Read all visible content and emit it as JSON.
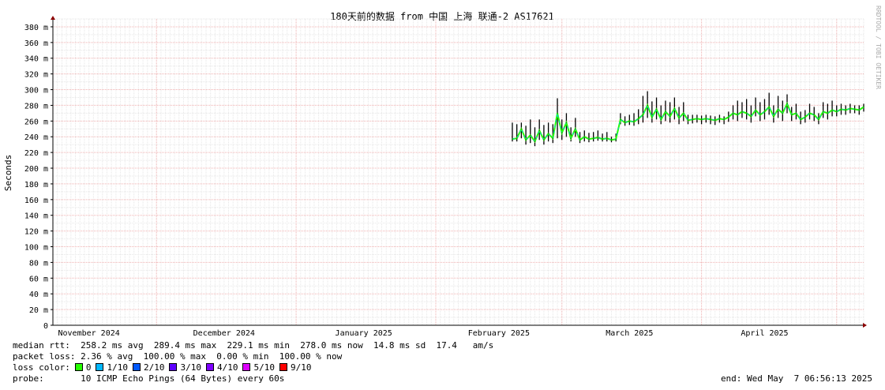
{
  "chart_data": {
    "type": "line",
    "title": "180天前的数据 from 中国 上海 联通-2 AS17621",
    "ylabel": "Seconds",
    "watermark": "RRDTOOL / TOBI OETIKER",
    "ylim": [
      0,
      390
    ],
    "yticks": [
      0,
      20,
      40,
      60,
      80,
      100,
      120,
      140,
      160,
      180,
      200,
      220,
      240,
      260,
      280,
      300,
      320,
      340,
      360,
      380
    ],
    "ytick_labels": [
      "0",
      "20 m",
      "40 m",
      "60 m",
      "80 m",
      "100 m",
      "120 m",
      "140 m",
      "160 m",
      "180 m",
      "200 m",
      "220 m",
      "240 m",
      "260 m",
      "280 m",
      "300 m",
      "320 m",
      "340 m",
      "360 m",
      "380 m"
    ],
    "xlim": [
      "2024-11-08",
      "2025-05-07"
    ],
    "xticks": [
      {
        "label": "November 2024",
        "date": "2024-11-16"
      },
      {
        "label": "December 2024",
        "date": "2024-12-16"
      },
      {
        "label": "January 2025",
        "date": "2025-01-16"
      },
      {
        "label": "February 2025",
        "date": "2025-02-15"
      },
      {
        "label": "March 2025",
        "date": "2025-03-16"
      },
      {
        "label": "April 2025",
        "date": "2025-04-15"
      }
    ],
    "grid": true,
    "series": [
      {
        "name": "median rtt",
        "x": [
          "2025-02-18",
          "2025-02-19",
          "2025-02-20",
          "2025-02-21",
          "2025-02-22",
          "2025-02-23",
          "2025-02-24",
          "2025-02-25",
          "2025-02-26",
          "2025-02-27",
          "2025-02-28",
          "2025-03-01",
          "2025-03-02",
          "2025-03-03",
          "2025-03-04",
          "2025-03-05",
          "2025-03-06",
          "2025-03-07",
          "2025-03-08",
          "2025-03-09",
          "2025-03-10",
          "2025-03-11",
          "2025-03-12",
          "2025-03-13",
          "2025-03-14",
          "2025-03-15",
          "2025-03-16",
          "2025-03-17",
          "2025-03-18",
          "2025-03-19",
          "2025-03-20",
          "2025-03-21",
          "2025-03-22",
          "2025-03-23",
          "2025-03-24",
          "2025-03-25",
          "2025-03-26",
          "2025-03-27",
          "2025-03-28",
          "2025-03-29",
          "2025-03-30",
          "2025-03-31",
          "2025-04-01",
          "2025-04-02",
          "2025-04-03",
          "2025-04-04",
          "2025-04-05",
          "2025-04-06",
          "2025-04-07",
          "2025-04-08",
          "2025-04-09",
          "2025-04-10",
          "2025-04-11",
          "2025-04-12",
          "2025-04-13",
          "2025-04-14",
          "2025-04-15",
          "2025-04-16",
          "2025-04-17",
          "2025-04-18",
          "2025-04-19",
          "2025-04-20",
          "2025-04-21",
          "2025-04-22",
          "2025-04-23",
          "2025-04-24",
          "2025-04-25",
          "2025-04-26",
          "2025-04-27",
          "2025-04-28",
          "2025-04-29",
          "2025-04-30",
          "2025-05-01",
          "2025-05-02",
          "2025-05-03",
          "2025-05-04",
          "2025-05-05",
          "2025-05-06",
          "2025-05-07"
        ],
        "values": [
          237,
          238,
          250,
          236,
          242,
          234,
          248,
          236,
          244,
          238,
          270,
          245,
          258,
          238,
          250,
          236,
          240,
          237,
          238,
          239,
          237,
          238,
          236,
          237,
          262,
          258,
          260,
          259,
          263,
          268,
          280,
          265,
          275,
          262,
          272,
          266,
          276,
          264,
          270,
          261,
          262,
          263,
          262,
          263,
          262,
          261,
          263,
          262,
          265,
          270,
          268,
          272,
          270,
          266,
          274,
          268,
          272,
          278,
          266,
          275,
          270,
          282,
          268,
          270,
          262,
          265,
          270,
          268,
          262,
          272,
          270,
          274,
          272,
          275,
          274,
          276,
          275,
          274,
          278
        ],
        "spikes": [
          258,
          256,
          258,
          254,
          262,
          252,
          262,
          255,
          258,
          256,
          289,
          262,
          270,
          252,
          264,
          246,
          248,
          245,
          246,
          248,
          244,
          246,
          240,
          244,
          270,
          266,
          268,
          270,
          275,
          292,
          298,
          285,
          290,
          280,
          286,
          284,
          290,
          278,
          284,
          268,
          268,
          268,
          267,
          268,
          267,
          266,
          268,
          266,
          272,
          280,
          286,
          284,
          288,
          280,
          290,
          284,
          288,
          296,
          280,
          292,
          286,
          294,
          278,
          282,
          272,
          274,
          282,
          278,
          270,
          284,
          282,
          286,
          280,
          282,
          280,
          282,
          280,
          280,
          282
        ],
        "minima": [
          234,
          234,
          238,
          230,
          232,
          228,
          236,
          230,
          234,
          232,
          238,
          236,
          240,
          234,
          240,
          232,
          234,
          233,
          234,
          235,
          234,
          234,
          233,
          234,
          256,
          254,
          255,
          254,
          256,
          258,
          264,
          258,
          262,
          256,
          260,
          258,
          262,
          256,
          260,
          256,
          257,
          258,
          256,
          258,
          256,
          255,
          258,
          256,
          259,
          262,
          260,
          264,
          262,
          258,
          266,
          260,
          262,
          268,
          258,
          264,
          260,
          270,
          260,
          262,
          256,
          258,
          262,
          260,
          256,
          264,
          262,
          266,
          266,
          268,
          268,
          270,
          270,
          268,
          272
        ]
      }
    ],
    "stats": {
      "median_rtt_label": "median rtt:",
      "median_rtt_values": "258.2 ms avg  289.4 ms max  229.1 ms min  278.0 ms now  14.8 ms sd  17.4   am/s",
      "packet_loss_label": "packet loss:",
      "packet_loss_values": "2.36 % avg  100.00 % max  0.00 % min  100.00 % now",
      "loss_color_label": "loss color:",
      "loss_colors": [
        {
          "label": "0",
          "color": "#26ff00"
        },
        {
          "label": "1/10",
          "color": "#00b8ff"
        },
        {
          "label": "2/10",
          "color": "#0059ff"
        },
        {
          "label": "3/10",
          "color": "#5e00ff"
        },
        {
          "label": "4/10",
          "color": "#7e00ff"
        },
        {
          "label": "5/10",
          "color": "#dd00ff"
        },
        {
          "label": "9/10",
          "color": "#ff0000"
        }
      ],
      "probe_label": "probe:",
      "probe_value": "10 ICMP Echo Pings (64 Bytes) every 60s",
      "end_label": "end: Wed May  7 06:56:13 2025"
    }
  }
}
